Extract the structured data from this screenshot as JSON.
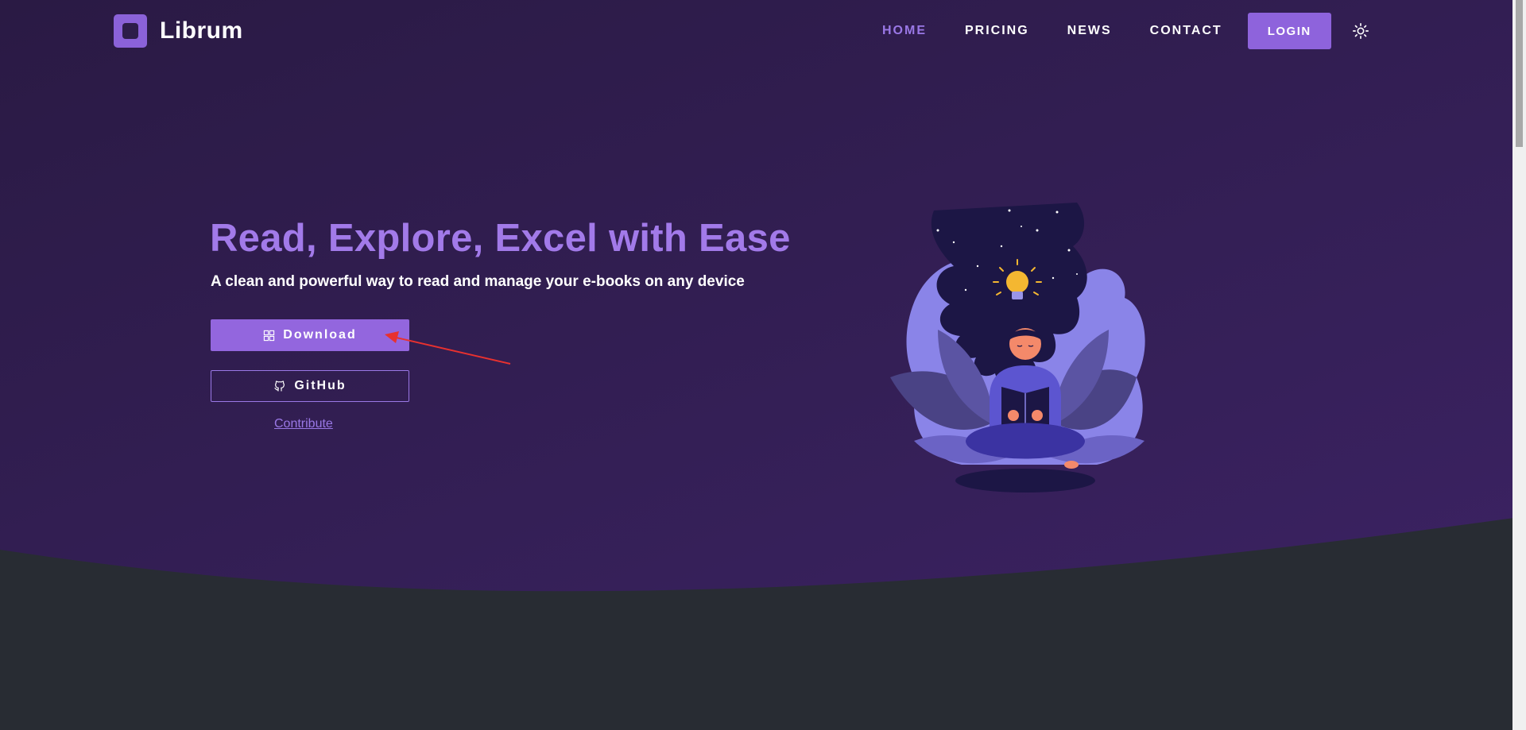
{
  "brand": {
    "name": "Librum",
    "logo_icon": "square-logo-icon",
    "accent_color": "#8b62d9"
  },
  "nav": {
    "items": [
      {
        "label": "HOME",
        "active": true
      },
      {
        "label": "PRICING",
        "active": false
      },
      {
        "label": "NEWS",
        "active": false
      },
      {
        "label": "CONTACT",
        "active": false
      }
    ],
    "login_label": "LOGIN",
    "theme_toggle_icon": "sun-icon"
  },
  "hero": {
    "title": "Read, Explore, Excel with Ease",
    "subtitle": "A clean and powerful way to read and manage your e-books on any device",
    "download_label": "Download",
    "download_icon": "windows-icon",
    "github_label": "GitHub",
    "github_icon": "github-icon",
    "contribute_label": "Contribute",
    "illustration": "woman-reading-lightbulb-illustration"
  },
  "colors": {
    "hero_bg_top": "#2c1b47",
    "hero_bg_bottom": "#3a2160",
    "footer_bg": "#282c33",
    "title": "#a27ae9",
    "button": "#9366de",
    "annotation_arrow": "#e8312f"
  }
}
